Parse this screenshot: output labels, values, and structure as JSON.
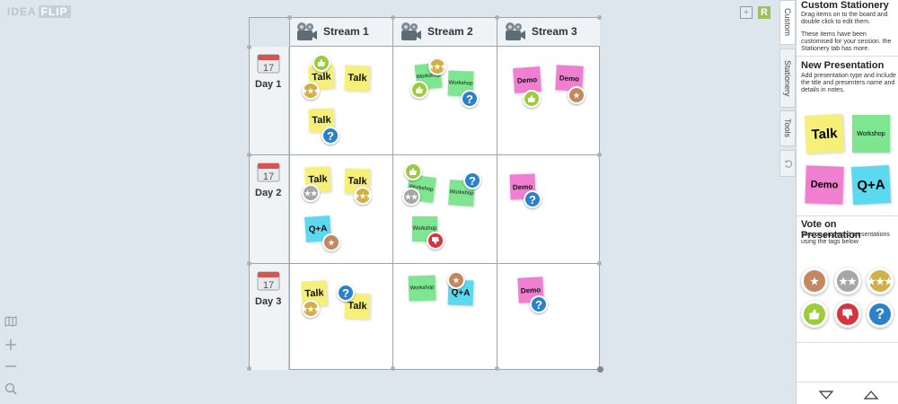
{
  "app": {
    "logo_idea": "IDEA",
    "logo_flip": "FLIP",
    "r_label": "R",
    "add_label": "+"
  },
  "board": {
    "columns": [
      "Stream 1",
      "Stream 2",
      "Stream 3"
    ],
    "rows": [
      {
        "label": "Day 1",
        "date": "17"
      },
      {
        "label": "Day 2",
        "date": "17"
      },
      {
        "label": "Day 3",
        "date": "17"
      }
    ]
  },
  "stickies": {
    "talk": "Talk",
    "workshop": "Workshop",
    "demo": "Demo",
    "qa": "Q+A"
  },
  "tags": {
    "question": "?"
  },
  "tabs": [
    "Custom",
    "Stationery",
    "Tools"
  ],
  "panel": {
    "custom_title": "Custom Stationery",
    "custom_text": "Drag items on to the board and double click to edit them.",
    "custom_text2": "These items have been customised for your session. the Stationery tab has more.",
    "new_title": "New Presentation",
    "new_text": "Add presentation type and include the title and presenters name and details in notes.",
    "vote_title": "Vote on Presentation",
    "vote_text": "Vote on proposed presentations using the tags below"
  },
  "colors": {
    "yellow": "#f6f07a",
    "green": "#7ee591",
    "pink": "#f07fd1",
    "cyan": "#5cd9ef",
    "gold": "#d1b04a",
    "silver": "#a6a6a6",
    "bronze": "#c38860",
    "like": "#9ccb3b",
    "dislike": "#d6343f",
    "question": "#2c82c9"
  }
}
